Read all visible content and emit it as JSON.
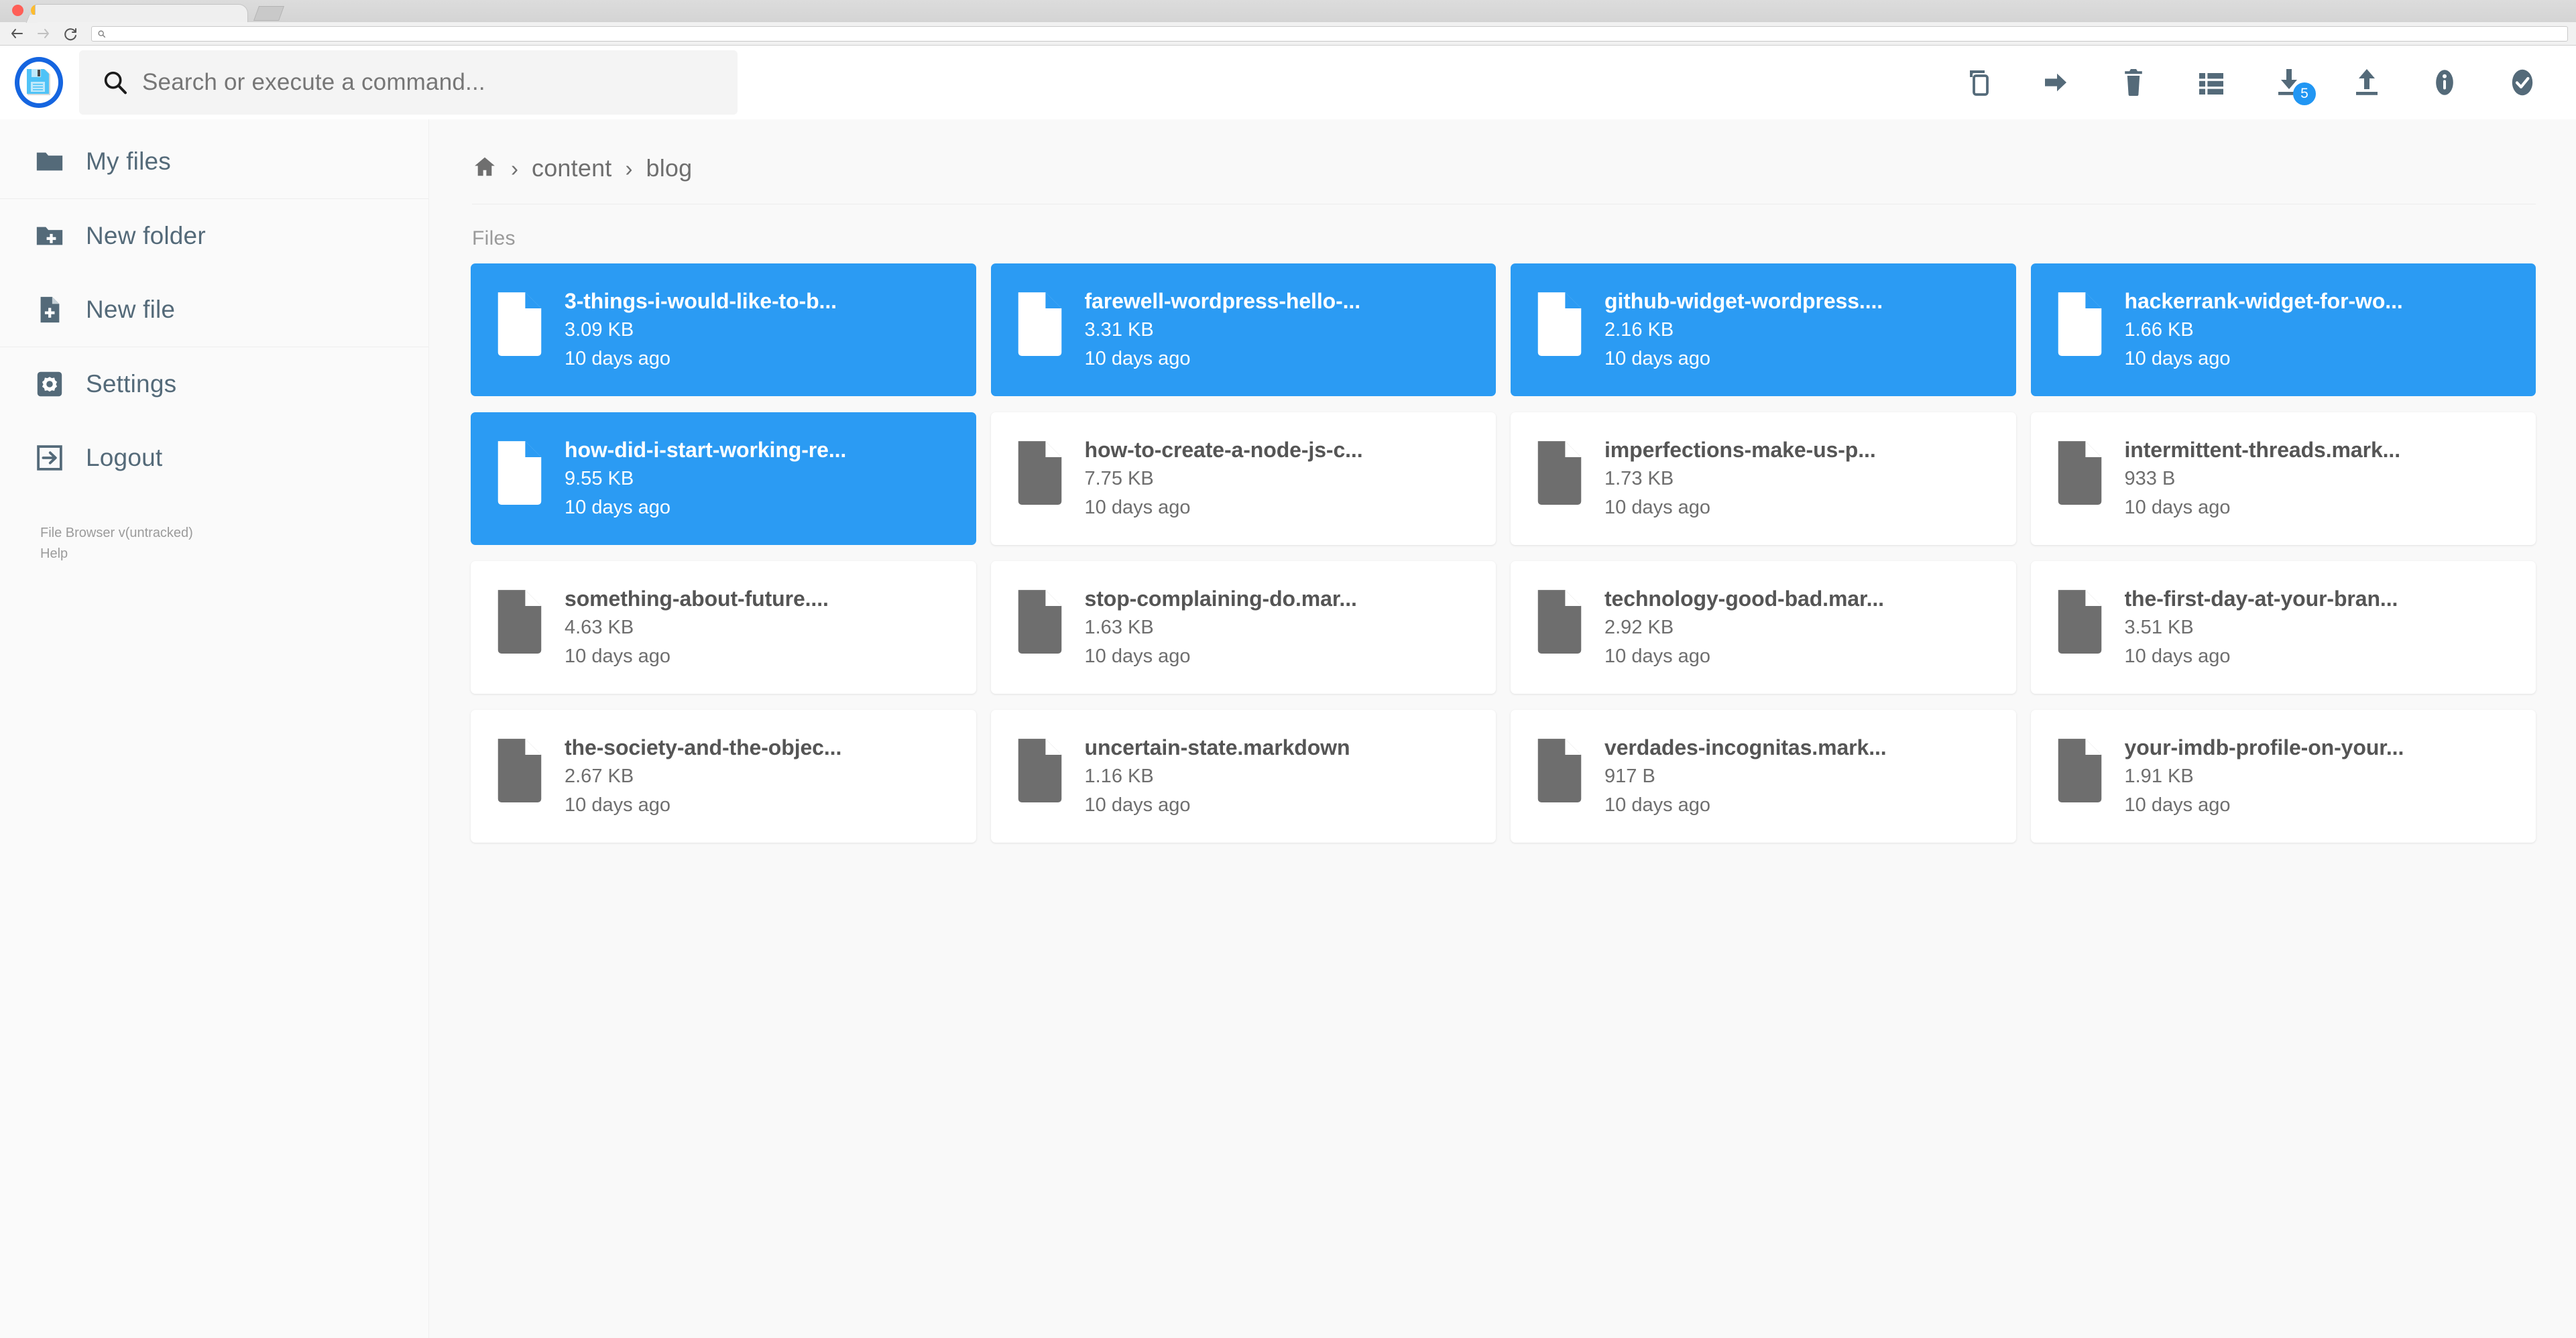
{
  "browser": {
    "back_icon": "arrow-left-icon",
    "forward_icon": "arrow-right-icon",
    "reload_icon": "reload-icon",
    "url_value": "",
    "url_search_icon": "search-icon",
    "tab_title": ""
  },
  "header": {
    "logo_name": "file-browser-logo",
    "search": {
      "placeholder": "Search or execute a command...",
      "value": "",
      "icon": "search-icon"
    },
    "toolbar": [
      {
        "name": "copy-button",
        "icon": "copy-icon",
        "badge": null
      },
      {
        "name": "move-button",
        "icon": "arrow-right-icon",
        "badge": null
      },
      {
        "name": "delete-button",
        "icon": "trash-icon",
        "badge": null
      },
      {
        "name": "switch-view-button",
        "icon": "list-view-icon",
        "badge": null
      },
      {
        "name": "download-button",
        "icon": "download-icon",
        "badge": "5"
      },
      {
        "name": "upload-button",
        "icon": "upload-icon",
        "badge": null
      },
      {
        "name": "info-button",
        "icon": "info-icon",
        "badge": null
      },
      {
        "name": "select-all-button",
        "icon": "check-circle-icon",
        "badge": null
      }
    ]
  },
  "sidebar": {
    "groups": [
      {
        "items": [
          {
            "label": "My files",
            "icon": "folder-icon",
            "name": "sidebar-item-my-files"
          }
        ]
      },
      {
        "items": [
          {
            "label": "New folder",
            "icon": "folder-plus-icon",
            "name": "sidebar-item-new-folder"
          },
          {
            "label": "New file",
            "icon": "file-plus-icon",
            "name": "sidebar-item-new-file"
          }
        ]
      },
      {
        "items": [
          {
            "label": "Settings",
            "icon": "gear-icon",
            "name": "sidebar-item-settings"
          },
          {
            "label": "Logout",
            "icon": "logout-icon",
            "name": "sidebar-item-logout"
          }
        ]
      }
    ],
    "footer": {
      "version": "File Browser v(untracked)",
      "help": "Help"
    }
  },
  "main": {
    "breadcrumb": {
      "home_icon": "home-icon",
      "separator": "›",
      "items": [
        "content",
        "blog"
      ]
    },
    "section_label": "Files",
    "files": [
      {
        "name": "3-things-i-would-like-to-b...",
        "size": "3.09 KB",
        "time": "10 days ago",
        "selected": true
      },
      {
        "name": "farewell-wordpress-hello-...",
        "size": "3.31 KB",
        "time": "10 days ago",
        "selected": true
      },
      {
        "name": "github-widget-wordpress....",
        "size": "2.16 KB",
        "time": "10 days ago",
        "selected": true
      },
      {
        "name": "hackerrank-widget-for-wo...",
        "size": "1.66 KB",
        "time": "10 days ago",
        "selected": true
      },
      {
        "name": "how-did-i-start-working-re...",
        "size": "9.55 KB",
        "time": "10 days ago",
        "selected": true
      },
      {
        "name": "how-to-create-a-node-js-c...",
        "size": "7.75 KB",
        "time": "10 days ago",
        "selected": false
      },
      {
        "name": "imperfections-make-us-p...",
        "size": "1.73 KB",
        "time": "10 days ago",
        "selected": false
      },
      {
        "name": "intermittent-threads.mark...",
        "size": "933 B",
        "time": "10 days ago",
        "selected": false
      },
      {
        "name": "something-about-future....",
        "size": "4.63 KB",
        "time": "10 days ago",
        "selected": false
      },
      {
        "name": "stop-complaining-do.mar...",
        "size": "1.63 KB",
        "time": "10 days ago",
        "selected": false
      },
      {
        "name": "technology-good-bad.mar...",
        "size": "2.92 KB",
        "time": "10 days ago",
        "selected": false
      },
      {
        "name": "the-first-day-at-your-bran...",
        "size": "3.51 KB",
        "time": "10 days ago",
        "selected": false
      },
      {
        "name": "the-society-and-the-objec...",
        "size": "2.67 KB",
        "time": "10 days ago",
        "selected": false
      },
      {
        "name": "uncertain-state.markdown",
        "size": "1.16 KB",
        "time": "10 days ago",
        "selected": false
      },
      {
        "name": "verdades-incognitas.mark...",
        "size": "917 B",
        "time": "10 days ago",
        "selected": false
      },
      {
        "name": "your-imdb-profile-on-your...",
        "size": "1.91 KB",
        "time": "10 days ago",
        "selected": false
      }
    ]
  },
  "colors": {
    "accent": "#2b9bf3",
    "badge": "#2196f3",
    "logo_ring": "#1565e0",
    "icon_gray": "#6e6e6e",
    "sidebar_text": "#546a79"
  }
}
